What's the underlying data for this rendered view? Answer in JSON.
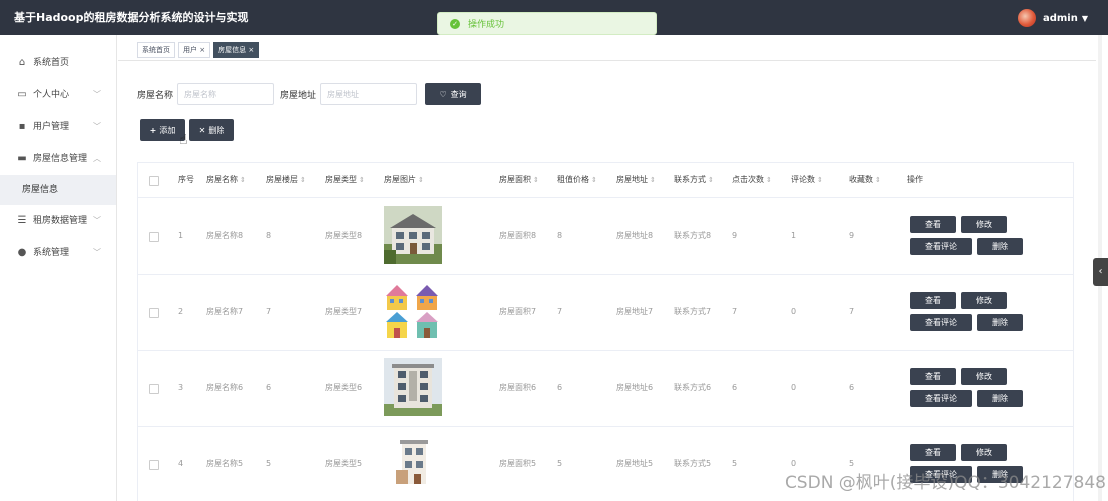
{
  "header": {
    "title": "基于Hadoop的租房数据分析系统的设计与实现",
    "user": "admin"
  },
  "toast": {
    "message": "操作成功"
  },
  "sidebar": {
    "items": [
      {
        "label": "系统首页",
        "icon": "home-icon"
      },
      {
        "label": "个人中心",
        "icon": "profile-icon"
      },
      {
        "label": "用户管理",
        "icon": "grid-icon"
      },
      {
        "label": "房屋信息管理",
        "icon": "monitor-icon"
      },
      {
        "label": "租房数据管理",
        "icon": "sliders-icon"
      },
      {
        "label": "系统管理",
        "icon": "location-icon"
      }
    ],
    "sub_item": "房屋信息"
  },
  "tabs": [
    {
      "label": "系统首页"
    },
    {
      "label": "用户 ×"
    },
    {
      "label": "房屋信息 ×"
    }
  ],
  "search": {
    "name_label": "房屋名称",
    "name_placeholder": "房屋名称",
    "address_label": "房屋地址",
    "address_placeholder": "房屋地址",
    "query_label": "查询"
  },
  "actions": {
    "add": "添加",
    "delete": "删除"
  },
  "table": {
    "columns": [
      "序号",
      "房屋名称",
      "房屋楼层",
      "房屋类型",
      "房屋图片",
      "房屋面积",
      "租值价格",
      "房屋地址",
      "联系方式",
      "点击次数",
      "评论数",
      "收藏数",
      "操作"
    ],
    "rows": [
      {
        "index": "1",
        "name": "房屋名称8",
        "floor": "8",
        "type": "房屋类型8",
        "area": "房屋面积8",
        "price": "8",
        "address": "房屋地址8",
        "contact": "联系方式8",
        "clicks": "9",
        "comments": "1",
        "favorites": "9"
      },
      {
        "index": "2",
        "name": "房屋名称7",
        "floor": "7",
        "type": "房屋类型7",
        "area": "房屋面积7",
        "price": "7",
        "address": "房屋地址7",
        "contact": "联系方式7",
        "clicks": "7",
        "comments": "0",
        "favorites": "7"
      },
      {
        "index": "3",
        "name": "房屋名称6",
        "floor": "6",
        "type": "房屋类型6",
        "area": "房屋面积6",
        "price": "6",
        "address": "房屋地址6",
        "contact": "联系方式6",
        "clicks": "6",
        "comments": "0",
        "favorites": "6"
      },
      {
        "index": "4",
        "name": "房屋名称5",
        "floor": "5",
        "type": "房屋类型5",
        "area": "房屋面积5",
        "price": "5",
        "address": "房屋地址5",
        "contact": "联系方式5",
        "clicks": "5",
        "comments": "0",
        "favorites": "5"
      }
    ],
    "buttons": {
      "view": "查看",
      "edit": "修改",
      "review": "查看评论",
      "remove": "删除"
    }
  },
  "watermark": "CSDN @枫叶(接毕设)QQ：3042127848",
  "colors": {
    "topbar": "#2f3541",
    "button": "#3a4250",
    "success": "#67c23a"
  }
}
